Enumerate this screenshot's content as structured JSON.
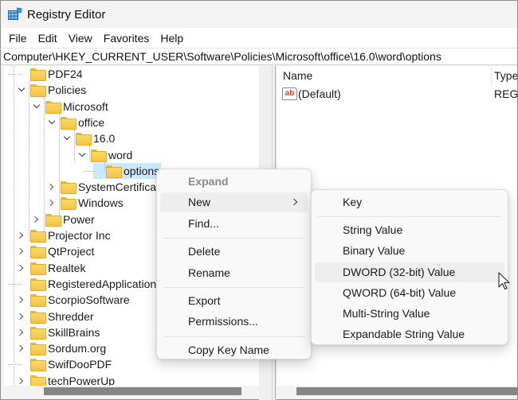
{
  "window": {
    "title": "Registry Editor",
    "app_icon": "registry-editor-icon"
  },
  "menubar": {
    "items": [
      "File",
      "Edit",
      "View",
      "Favorites",
      "Help"
    ]
  },
  "address_bar": {
    "path": "Computer\\HKEY_CURRENT_USER\\Software\\Policies\\Microsoft\\office\\16.0\\word\\options"
  },
  "tree": {
    "items": [
      {
        "label": "PDF24",
        "expander": "none",
        "depth": 1
      },
      {
        "label": "Policies",
        "expander": "expanded",
        "depth": 1
      },
      {
        "label": "Microsoft",
        "expander": "expanded",
        "depth": 2
      },
      {
        "label": "office",
        "expander": "expanded",
        "depth": 3
      },
      {
        "label": "16.0",
        "expander": "expanded",
        "depth": 4
      },
      {
        "label": "word",
        "expander": "expanded",
        "depth": 5
      },
      {
        "label": "options",
        "expander": "none",
        "depth": 6,
        "selected": true
      },
      {
        "label": "SystemCertificates",
        "expander": "collapsed",
        "depth": 3
      },
      {
        "label": "Windows",
        "expander": "collapsed",
        "depth": 3
      },
      {
        "label": "Power",
        "expander": "collapsed",
        "depth": 2
      },
      {
        "label": "Projector Inc",
        "expander": "collapsed",
        "depth": 1
      },
      {
        "label": "QtProject",
        "expander": "collapsed",
        "depth": 1
      },
      {
        "label": "Realtek",
        "expander": "collapsed",
        "depth": 1
      },
      {
        "label": "RegisteredApplications",
        "expander": "none",
        "depth": 1
      },
      {
        "label": "ScorpioSoftware",
        "expander": "collapsed",
        "depth": 1
      },
      {
        "label": "Shredder",
        "expander": "collapsed",
        "depth": 1
      },
      {
        "label": "SkillBrains",
        "expander": "collapsed",
        "depth": 1
      },
      {
        "label": "Sordum.org",
        "expander": "collapsed",
        "depth": 1
      },
      {
        "label": "SwifDooPDF",
        "expander": "none",
        "depth": 1
      },
      {
        "label": "techPowerUp",
        "expander": "collapsed",
        "depth": 1
      }
    ]
  },
  "values_list": {
    "columns": [
      "Name",
      "Type"
    ],
    "rows": [
      {
        "icon": "string-value-icon",
        "name": "(Default)",
        "type": "REG_SZ"
      }
    ]
  },
  "context_menu": {
    "items": [
      {
        "label": "Expand",
        "disabled": true
      },
      {
        "label": "New",
        "has_submenu": true,
        "highlighted": true
      },
      {
        "label": "Find..."
      },
      {
        "separator": true
      },
      {
        "label": "Delete"
      },
      {
        "label": "Rename"
      },
      {
        "separator": true
      },
      {
        "label": "Export"
      },
      {
        "label": "Permissions..."
      },
      {
        "separator": true
      },
      {
        "label": "Copy Key Name"
      }
    ]
  },
  "new_submenu": {
    "items": [
      {
        "label": "Key"
      },
      {
        "separator": true
      },
      {
        "label": "String Value"
      },
      {
        "label": "Binary Value"
      },
      {
        "label": "DWORD (32-bit) Value",
        "highlighted": true
      },
      {
        "label": "QWORD (64-bit) Value"
      },
      {
        "label": "Multi-String Value"
      },
      {
        "label": "Expandable String Value"
      }
    ]
  },
  "colors": {
    "selection": "#cce8ff",
    "folder": "#f5c542",
    "menu_hover": "#eeeeee",
    "scroll_thumb": "#858585"
  }
}
